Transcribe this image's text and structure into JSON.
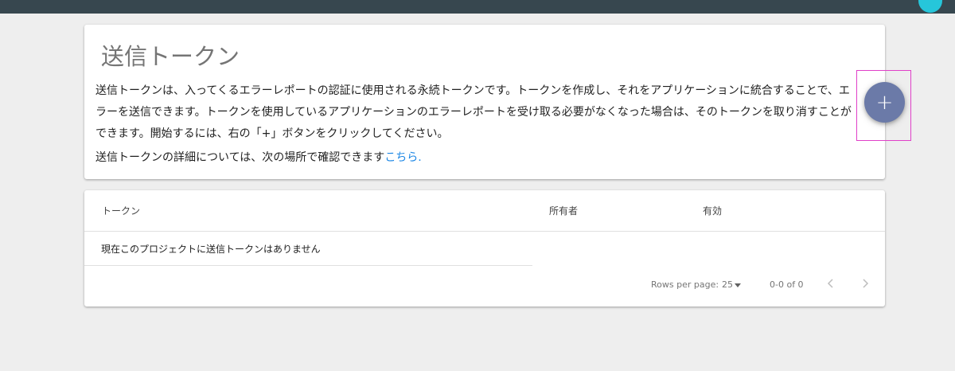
{
  "header": {
    "bar_color": "#37474f",
    "avatar_color": "#26c6da"
  },
  "intro": {
    "title": "送信トークン",
    "description": "送信トークンは、入ってくるエラーレポートの認証に使用される永続トークンです。トークンを作成し、それをアプリケーションに統合することで、エラーを送信できます。トークンを使用しているアプリケーションのエラーレポートを受け取る必要がなくなった場合は、そのトークンを取り消すことができます。開始するには、右の「+」ボタンをクリックしてください。",
    "more_info_text": "送信トークンの詳細については、次の場所で確認できます",
    "more_info_link": "こちら.",
    "link_color": "#1e88e5"
  },
  "add_button": {
    "icon": "plus-icon",
    "glyph": "+",
    "color": "#6b7aa8",
    "highlight_color": "#e040c8"
  },
  "table": {
    "columns": [
      "トークン",
      "所有者",
      "有効"
    ],
    "empty_message": "現在このプロジェクトに送信トークンはありません"
  },
  "pagination": {
    "rows_per_page_label": "Rows per page:",
    "rows_per_page_value": "25",
    "range": "0-0 of 0",
    "prev_icon": "chevron-left-icon",
    "next_icon": "chevron-right-icon"
  }
}
